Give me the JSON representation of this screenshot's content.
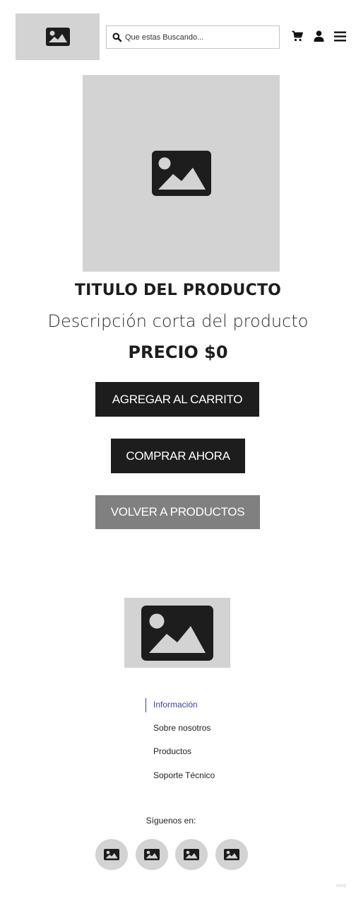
{
  "header": {
    "logo_icon": "image-placeholder-icon",
    "search": {
      "placeholder": "Que estas Buscando...",
      "value": "",
      "icon": "search-icon"
    },
    "icons": [
      "cart-icon",
      "user-icon",
      "menu-icon"
    ]
  },
  "product": {
    "image_icon": "image-placeholder-icon",
    "title": "TITULO DEL PRODUCTO",
    "description": "Descripción corta del producto",
    "price": "PRECIO $0"
  },
  "buttons": {
    "add_to_cart": "AGREGAR AL CARRITO",
    "buy_now": "COMPRAR AHORA",
    "back": "VOLVER A PRODUCTOS"
  },
  "footer": {
    "logo_icon": "image-placeholder-icon",
    "links": [
      "Información",
      "Sobre nosotros",
      "Productos",
      "Soporte Técnico"
    ],
    "active_link": "Información",
    "follow_label": "Síguenos en:",
    "social_icons": [
      "image-placeholder-icon",
      "image-placeholder-icon",
      "image-placeholder-icon",
      "image-placeholder-icon"
    ]
  },
  "watermark": "miro",
  "colors": {
    "placeholder_bg": "#d3d3d3",
    "primary_button": "#1d1d1d",
    "secondary_button": "#808080",
    "active_link": "#3a3fa8"
  }
}
